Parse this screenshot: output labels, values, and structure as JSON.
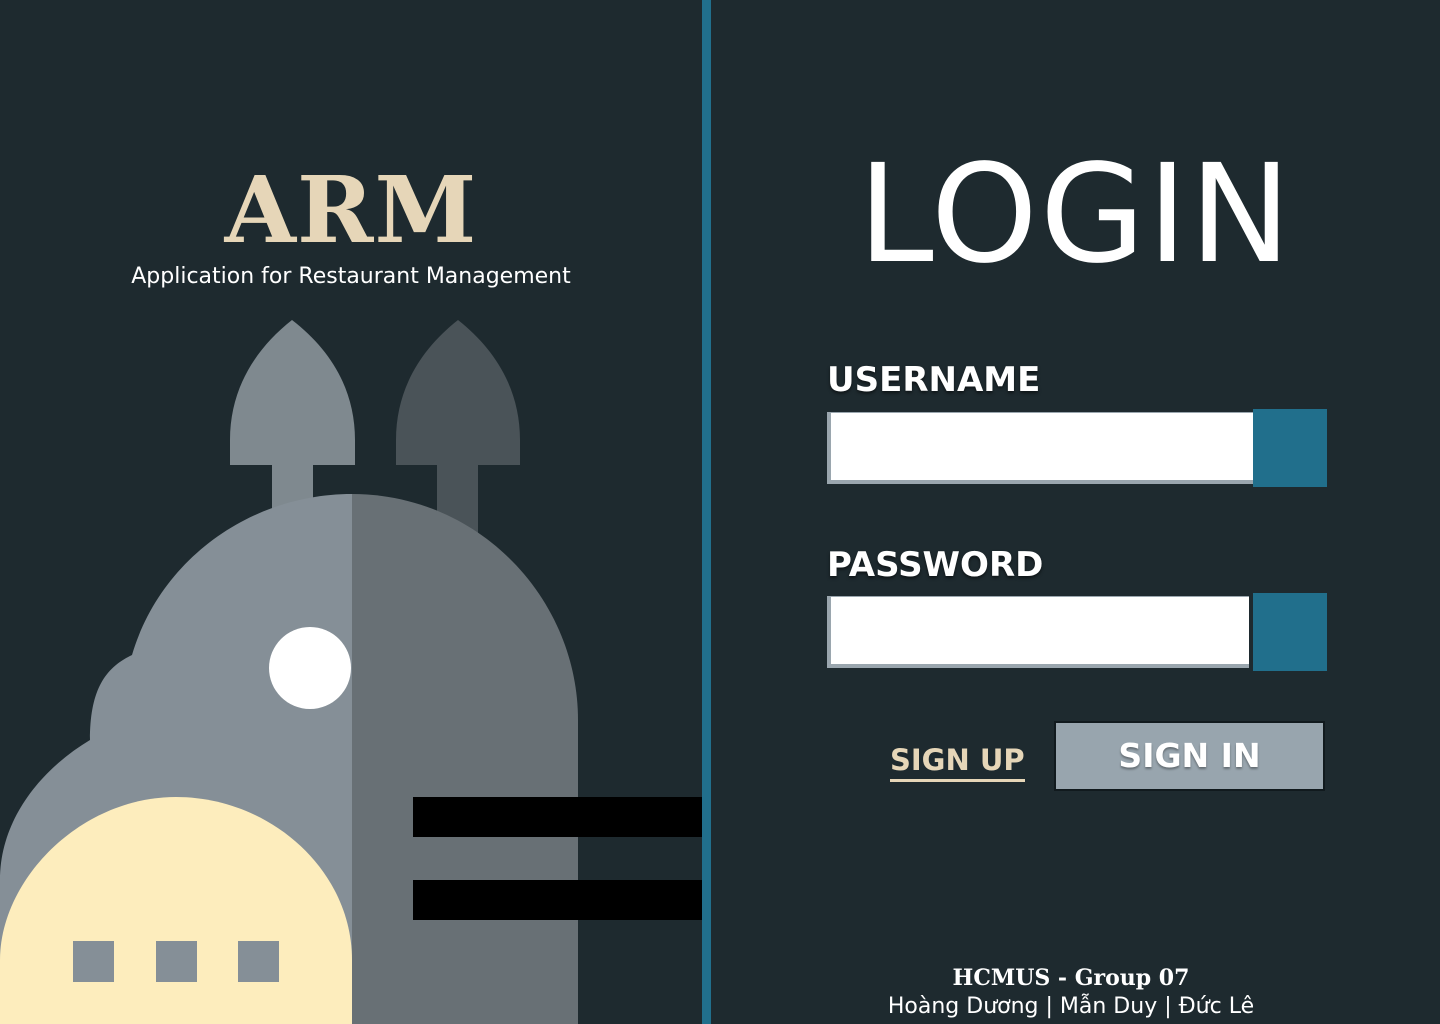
{
  "brand": {
    "title": "ARM",
    "subtitle": "Application for Restaurant Management"
  },
  "login": {
    "title": "LOGIN",
    "username_label": "USERNAME",
    "username_value": "",
    "password_label": "PASSWORD",
    "password_value": "",
    "signup_label": "SIGN UP",
    "signin_label": "SIGN IN"
  },
  "footer": {
    "title": "HCMUS - Group 07",
    "names": "Hoàng Dương | Mẫn Duy | Đức Lê"
  },
  "colors": {
    "background": "#1e2a2f",
    "accent_blue": "#216f8c",
    "brand_cream": "#e6d6b8",
    "button_gray": "#98a5ae",
    "dome_light": "#858f97",
    "dome_dark": "#687075",
    "building_yellow": "#fdedbd"
  },
  "illustration": {
    "icon": "domed-restaurant-building-illustration"
  }
}
